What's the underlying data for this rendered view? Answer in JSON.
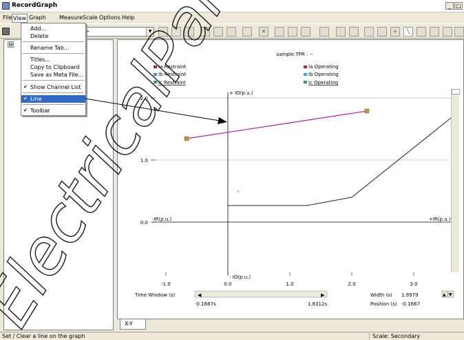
{
  "window": {
    "title": "RecordGraph",
    "min_glyph": "_",
    "max_glyph": "□"
  },
  "menubar": {
    "items": [
      {
        "label": "File"
      },
      {
        "label": "View"
      },
      {
        "label": "Graph"
      },
      {
        "label": "Measure"
      },
      {
        "label": "Scale"
      },
      {
        "label": "Options"
      },
      {
        "label": "Help"
      }
    ]
  },
  "toolbar": {
    "combo_value": ">"
  },
  "view_menu": {
    "items": [
      "Add...",
      "Delete",
      "Rename Tab...",
      "Titles...",
      "Copy to Clipboard",
      "Save as Meta File...",
      "Show Channel List",
      "Line",
      "Toolbar"
    ],
    "check": "✔"
  },
  "tree": {
    "node_glyph": "⊟"
  },
  "graph": {
    "title": "sample.TPR : --",
    "legend_left": [
      "Ia Restraint",
      "Ib Restraint",
      "Ic Restraint"
    ],
    "legend_right": [
      "Ia Operating",
      "Ib Operating",
      "Ic Operating"
    ],
    "axis_labels": {
      "pos_y": "+ IO(p.u.)",
      "neg_y": "- IO(p.u.)",
      "pos_x": "+IR(p.u.)",
      "neg_x": "-IR(p.u.)"
    },
    "ytick_labels": [
      "2.0",
      "1.0",
      "0.0"
    ],
    "xtick_labels": [
      "-1.0",
      "0.0",
      "1.0",
      "2.0",
      "3.0"
    ],
    "time_window_label": "Time Window (s)",
    "time_start": "-0.1667s",
    "time_end": "1.8312s",
    "width_label": "Width (s)",
    "width_value": "1.9979",
    "position_label": "Position (s)",
    "position_value": "-0.1667",
    "colors": {
      "ia_restraint": "#b02040",
      "ib_restraint": "#2aa0c0",
      "ic_restraint": "#20a080",
      "ia_operating": "#b02040",
      "ib_operating": "#28b0e0",
      "ic_operating": "#20a080",
      "user_line": "#b020b0",
      "marker": "#b89a40",
      "characteristic": "#222222"
    },
    "annotation_arrow": "line from View > Line menu item to the graph"
  },
  "tabs": [
    {
      "label": "X-Y"
    }
  ],
  "status": {
    "text": "Set / Clear a line on the graph",
    "scale": "Scale: Secondary"
  },
  "watermark": {
    "text": "ElectricalPartManuals"
  }
}
